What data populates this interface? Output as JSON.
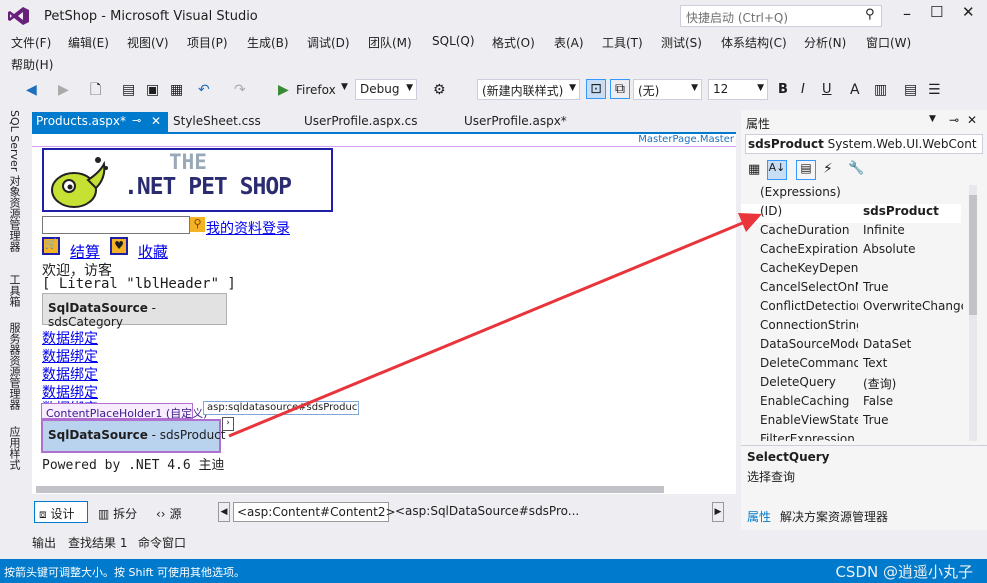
{
  "window": {
    "title": "PetShop - Microsoft Visual Studio",
    "quick_launch": "快捷启动 (Ctrl+Q)"
  },
  "menu": [
    "文件(F)",
    "编辑(E)",
    "视图(V)",
    "项目(P)",
    "生成(B)",
    "调试(D)",
    "团队(M)",
    "SQL(Q)",
    "格式(O)",
    "表(A)",
    "工具(T)",
    "测试(S)",
    "体系结构(C)",
    "分析(N)",
    "窗口(W)",
    "帮助(H)"
  ],
  "toolbar": {
    "run_target": "Firefox",
    "config": "Debug",
    "style_mode": "(新建内联样式)",
    "font_name": "(无)",
    "font_size": "12",
    "bold": "B",
    "italic": "I",
    "underline": "U"
  },
  "left_tabs": [
    "SQL Server 对象资源管理器",
    "工具箱",
    "服务器资源管理器",
    "应用样式"
  ],
  "doc_tabs": [
    "Products.aspx*",
    "StyleSheet.css",
    "UserProfile.aspx.cs",
    "UserProfile.aspx*"
  ],
  "designer": {
    "master_label": "MasterPage.Master",
    "logo_the": "THE",
    "logo_main": ".NET PET SHOP",
    "login_link": "我的资料登录",
    "checkout_link": "结算",
    "favorites_link": "收藏",
    "welcome": "欢迎，访客",
    "literal": "[ Literal \"lblHeader\" ]",
    "sds_category_bold": "SqlDataSource",
    "sds_category_rest": " - sdsCategory",
    "bind_links": [
      "数据绑定",
      "数据绑定",
      "数据绑定",
      "数据绑定",
      "数据绑定"
    ],
    "content_placeholder": "ContentPlaceHolder1 (自定义)",
    "asp_tag": "asp:sqldatasource#sdsProduct",
    "sds_product_bold": "SqlDataSource",
    "sds_product_rest": " - sdsProduct",
    "footer": "Powered by .NET 4.6 主迪"
  },
  "bottom": {
    "design": "设计",
    "split": "拆分",
    "source": "源",
    "crumb1": "<asp:Content#Content2>",
    "crumb2": "<asp:SqlDataSource#sdsPro..."
  },
  "output_tabs": [
    "输出",
    "查找结果 1",
    "命令窗口"
  ],
  "status": "按箭头键可调整大小。按 Shift 可使用其他选项。",
  "watermark": "CSDN @逍遥小丸子",
  "properties": {
    "title": "属性",
    "object_name": "sdsProduct",
    "object_type": "System.Web.UI.WebCont",
    "rows": [
      {
        "name": "(Expressions)",
        "value": ""
      },
      {
        "name": "(ID)",
        "value": "sdsProduct"
      },
      {
        "name": "CacheDuration",
        "value": "Infinite"
      },
      {
        "name": "CacheExpirationP",
        "value": "Absolute"
      },
      {
        "name": "CacheKeyDepend",
        "value": ""
      },
      {
        "name": "CancelSelectOnN",
        "value": "True"
      },
      {
        "name": "ConflictDetection",
        "value": "OverwriteChange"
      },
      {
        "name": "ConnectionString",
        "value": ""
      },
      {
        "name": "DataSourceMode",
        "value": "DataSet"
      },
      {
        "name": "DeleteCommand",
        "value": "Text"
      },
      {
        "name": "DeleteQuery",
        "value": "(查询)"
      },
      {
        "name": "EnableCaching",
        "value": "False"
      },
      {
        "name": "EnableViewState",
        "value": "True"
      },
      {
        "name": "FilterExpression",
        "value": ""
      }
    ],
    "desc_title": "SelectQuery",
    "desc_text": "选择查询",
    "tab_props": "属性",
    "tab_solution": "解决方案资源管理器"
  },
  "colors": {
    "accent": "#007acc",
    "annotation": "#e8343a"
  }
}
